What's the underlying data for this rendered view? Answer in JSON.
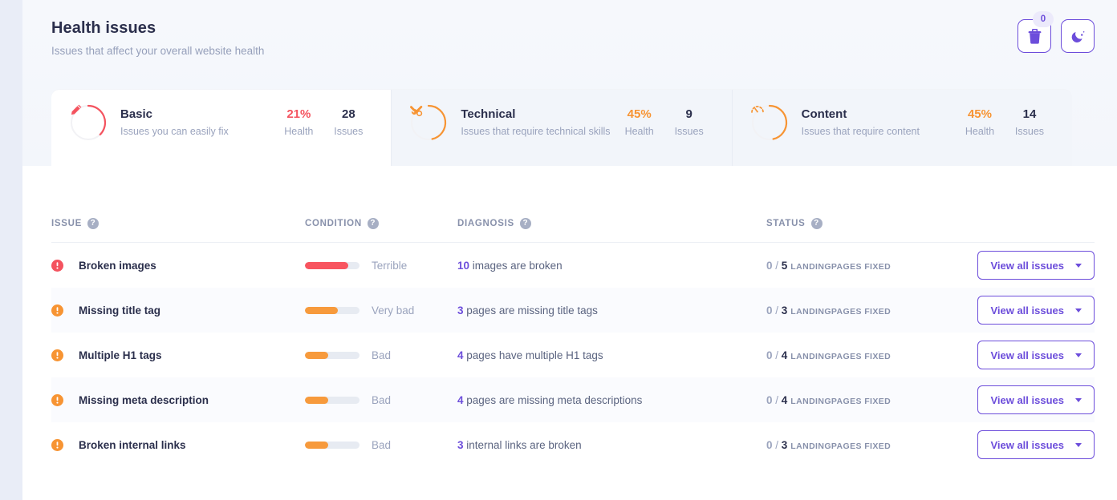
{
  "header": {
    "title": "Health issues",
    "subtitle": "Issues that affect your overall website health",
    "delete_badge": "0",
    "delete_icon": "trash-icon",
    "theme_icon": "moon-icon"
  },
  "categories": [
    {
      "name": "Basic",
      "desc": "Issues you can easily fix",
      "health": "21%",
      "health_label": "Health",
      "issues": "28",
      "issues_label": "Issues",
      "icon": "pencil-icon",
      "color": "#f4535f",
      "percent": 21,
      "active": true
    },
    {
      "name": "Technical",
      "desc": "Issues that require technical skills",
      "health": "45%",
      "health_label": "Health",
      "issues": "9",
      "issues_label": "Issues",
      "icon": "tools-icon",
      "color": "#f79433",
      "percent": 45,
      "active": false
    },
    {
      "name": "Content",
      "desc": "Issues that require content",
      "health": "45%",
      "health_label": "Health",
      "issues": "14",
      "issues_label": "Issues",
      "icon": "gauge-icon",
      "color": "#f79433",
      "percent": 45,
      "active": false
    }
  ],
  "table": {
    "columns": [
      {
        "label": "ISSUE",
        "help": "?"
      },
      {
        "label": "CONDITION",
        "help": "?"
      },
      {
        "label": "DIAGNOSIS",
        "help": "?"
      },
      {
        "label": "STATUS",
        "help": "?"
      }
    ],
    "action_label": "View all issues",
    "rows": [
      {
        "issue": "Broken images",
        "severity_color": "#f4535f",
        "condition": "Terrible",
        "bar_percent": 80,
        "bar_color": "#f8545f",
        "diag_count": "10",
        "diag_text": "images are broken",
        "fixed": "0",
        "total": "5",
        "unit": "LANDINGPAGES FIXED",
        "action": "View all issues"
      },
      {
        "issue": "Missing title tag",
        "severity_color": "#f79433",
        "condition": "Very bad",
        "bar_percent": 60,
        "bar_color": "#f79a3c",
        "diag_count": "3",
        "diag_text": "pages are missing title tags",
        "fixed": "0",
        "total": "3",
        "unit": "LANDINGPAGES FIXED",
        "action": "View all issues"
      },
      {
        "issue": "Multiple H1 tags",
        "severity_color": "#f79433",
        "condition": "Bad",
        "bar_percent": 42,
        "bar_color": "#f79a3c",
        "diag_count": "4",
        "diag_text": "pages have multiple H1 tags",
        "fixed": "0",
        "total": "4",
        "unit": "LANDINGPAGES FIXED",
        "action": "View all issues"
      },
      {
        "issue": "Missing meta description",
        "severity_color": "#f79433",
        "condition": "Bad",
        "bar_percent": 42,
        "bar_color": "#f79a3c",
        "diag_count": "4",
        "diag_text": "pages are missing meta descriptions",
        "fixed": "0",
        "total": "4",
        "unit": "LANDINGPAGES FIXED",
        "action": "View all issues"
      },
      {
        "issue": "Broken internal links",
        "severity_color": "#f79433",
        "condition": "Bad",
        "bar_percent": 42,
        "bar_color": "#f79a3c",
        "diag_count": "3",
        "diag_text": "internal links are broken",
        "fixed": "0",
        "total": "3",
        "unit": "LANDINGPAGES FIXED",
        "action": "View all issues"
      }
    ]
  },
  "colors": {
    "accent": "#6c4ddb",
    "danger": "#f4535f",
    "warning": "#f79433",
    "text": "#2b2f4c",
    "muted": "#9aa3bd"
  }
}
